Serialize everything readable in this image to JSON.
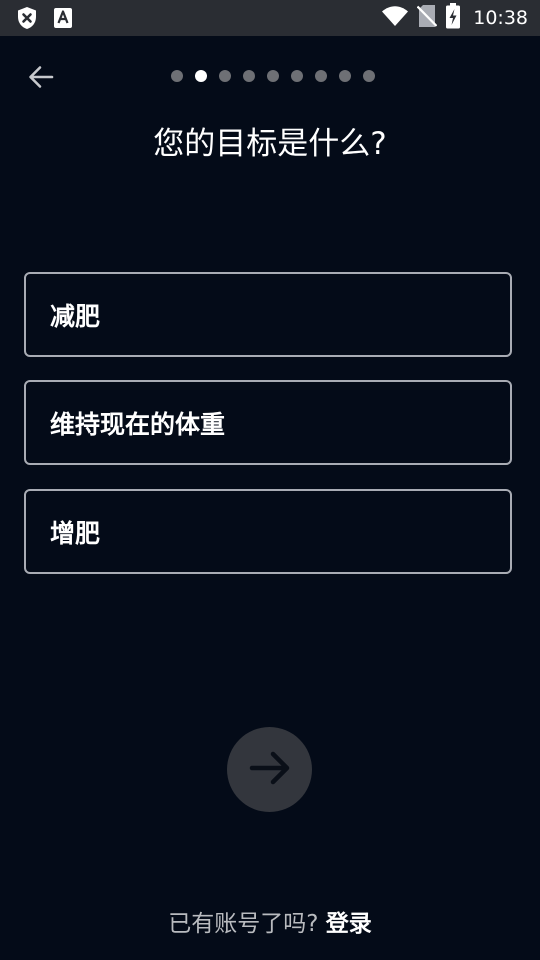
{
  "status_bar": {
    "time": "10:38",
    "icons": [
      "shield-x-icon",
      "font-a-icon",
      "wifi-icon",
      "no-sim-icon",
      "battery-charging-icon"
    ]
  },
  "header": {
    "back_icon": "arrow-left-icon",
    "progress": {
      "total_steps": 9,
      "current_step": 2
    },
    "title": "您的目标是什么?"
  },
  "options": [
    {
      "label": "减肥"
    },
    {
      "label": "维持现在的体重"
    },
    {
      "label": "增肥"
    }
  ],
  "next_button": {
    "icon": "arrow-right-icon"
  },
  "footer": {
    "prompt": "已有账号了吗?",
    "login_label": "登录"
  },
  "colors": {
    "background": "#040b18",
    "status_bar": "#2a2d33",
    "option_border": "#a9acb4",
    "dot_inactive": "#6e7075",
    "dot_active": "#ffffff",
    "next_button_bg": "#33363d",
    "next_button_arrow": "#0a0f18"
  }
}
